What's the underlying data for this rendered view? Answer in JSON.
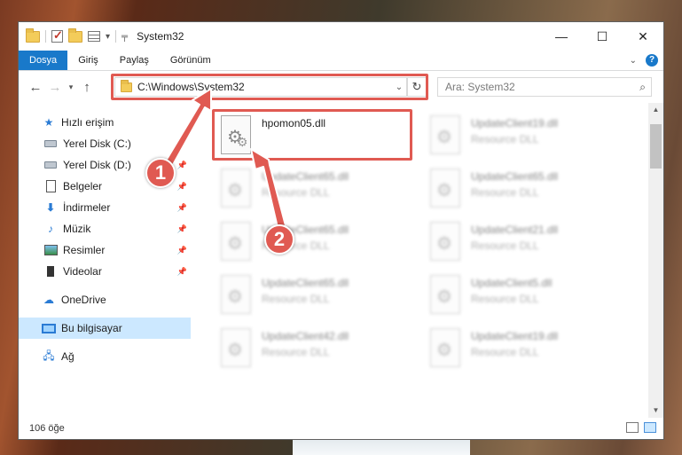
{
  "window": {
    "title": "System32",
    "minimize_icon": "minimize-icon",
    "maximize_icon": "maximize-icon",
    "close_icon": "close-icon"
  },
  "ribbon": {
    "tabs": [
      {
        "label": "Dosya",
        "active": true
      },
      {
        "label": "Giriş",
        "active": false
      },
      {
        "label": "Paylaş",
        "active": false
      },
      {
        "label": "Görünüm",
        "active": false
      }
    ]
  },
  "address": {
    "path": "C:\\Windows\\System32",
    "search_placeholder": "Ara: System32"
  },
  "sidebar": {
    "quick_access": "Hızlı erişim",
    "items": [
      {
        "label": "Yerel Disk (C:)",
        "pinned": false
      },
      {
        "label": "Yerel Disk (D:)",
        "pinned": true
      },
      {
        "label": "Belgeler",
        "pinned": true
      },
      {
        "label": "İndirmeler",
        "pinned": true
      },
      {
        "label": "Müzik",
        "pinned": true
      },
      {
        "label": "Resimler",
        "pinned": true
      },
      {
        "label": "Videolar",
        "pinned": true
      }
    ],
    "onedrive": "OneDrive",
    "this_pc": "Bu bilgisayar",
    "network": "Ağ"
  },
  "files": [
    {
      "name": "hpomon05.dll",
      "type": "",
      "highlighted": true
    },
    {
      "name": "UpdateClient19.dll",
      "type": "Resource DLL"
    },
    {
      "name": "UpdateClient65.dll",
      "type": "Resource DLL"
    },
    {
      "name": "UpdateClient65.dll",
      "type": "Resource DLL"
    },
    {
      "name": "UpdateClient65.dll",
      "type": "Resource DLL"
    },
    {
      "name": "UpdateClient21.dll",
      "type": "Resource DLL"
    },
    {
      "name": "UpdateClient65.dll",
      "type": "Resource DLL"
    },
    {
      "name": "UpdateClient5.dll",
      "type": "Resource DLL"
    },
    {
      "name": "UpdateClient42.dll",
      "type": "Resource DLL"
    },
    {
      "name": "UpdateClient19.dll",
      "type": "Resource DLL"
    }
  ],
  "status": {
    "count": "106 öğe"
  },
  "callouts": [
    "1",
    "2"
  ],
  "colors": {
    "accent": "#1979ca",
    "highlight": "#e05a52",
    "selected": "#cce8ff"
  }
}
